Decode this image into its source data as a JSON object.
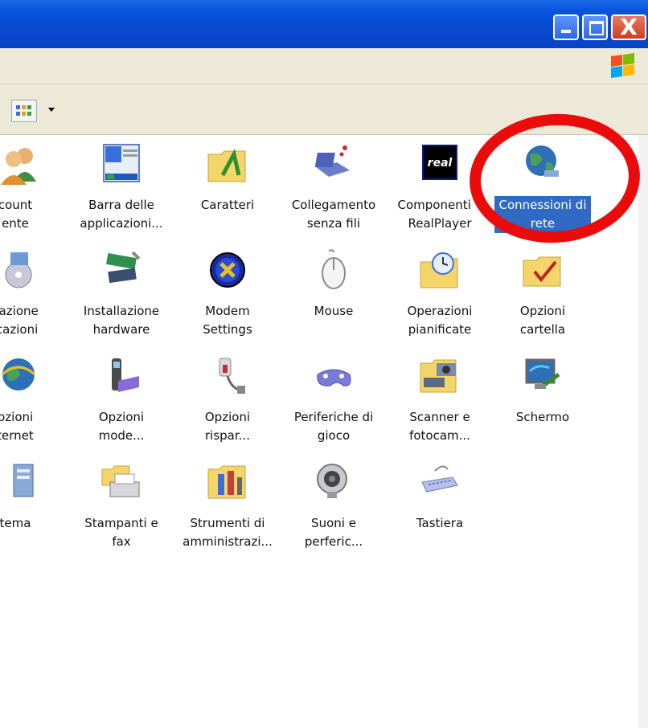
{
  "window": {
    "buttons": [
      "minimize-icon",
      "maximize-icon",
      "close-icon"
    ],
    "close_glyph": "X"
  },
  "toolbar": {
    "view_icon": "view-icon"
  },
  "items": [
    {
      "label": "count\nente",
      "icon": "user-accounts-icon"
    },
    {
      "label": "Barra delle\napplicazioni...",
      "icon": "taskbar-icon"
    },
    {
      "label": "Caratteri",
      "icon": "fonts-folder-icon"
    },
    {
      "label": "Collegamento\nsenza fili",
      "icon": "wireless-laptop-icon"
    },
    {
      "label": "Componenti  i\nRealPlayer",
      "icon": "realplayer-icon"
    },
    {
      "label": "Connessioni di\nrete",
      "icon": "network-globe-icon",
      "selected": true
    },
    {
      "label": "llazione\nicazioni",
      "icon": "add-remove-programs-icon"
    },
    {
      "label": "Installazione\nhardware",
      "icon": "hardware-wizard-icon"
    },
    {
      "label": "Modem\nSettings",
      "icon": "modem-settings-icon"
    },
    {
      "label": "Mouse",
      "icon": "mouse-icon"
    },
    {
      "label": "Operazioni\npianificate",
      "icon": "scheduled-tasks-icon"
    },
    {
      "label": "Opzioni\ncartella",
      "icon": "folder-options-icon"
    },
    {
      "label": "pzioni\nternet",
      "icon": "internet-options-icon"
    },
    {
      "label": "Opzioni\nmode...",
      "icon": "phone-modem-icon"
    },
    {
      "label": "Opzioni\nrispar...",
      "icon": "power-options-icon"
    },
    {
      "label": "Periferiche di\ngioco",
      "icon": "gamepad-icon"
    },
    {
      "label": "Scanner e\nfotocam...",
      "icon": "scanner-camera-icon"
    },
    {
      "label": "Schermo",
      "icon": "display-icon"
    },
    {
      "label": "tema",
      "icon": "system-icon"
    },
    {
      "label": "Stampanti e\nfax",
      "icon": "printer-icon"
    },
    {
      "label": "Strumenti di\namministrazi...",
      "icon": "admin-tools-icon"
    },
    {
      "label": "Suoni e\nperferic...",
      "icon": "speaker-icon"
    },
    {
      "label": "Tastiera",
      "icon": "keyboard-icon"
    }
  ],
  "colors": {
    "titlebar": "#0a55de",
    "selection": "#316ac5",
    "highlight_circle": "#ec0b0b",
    "chrome": "#ece9d8"
  }
}
